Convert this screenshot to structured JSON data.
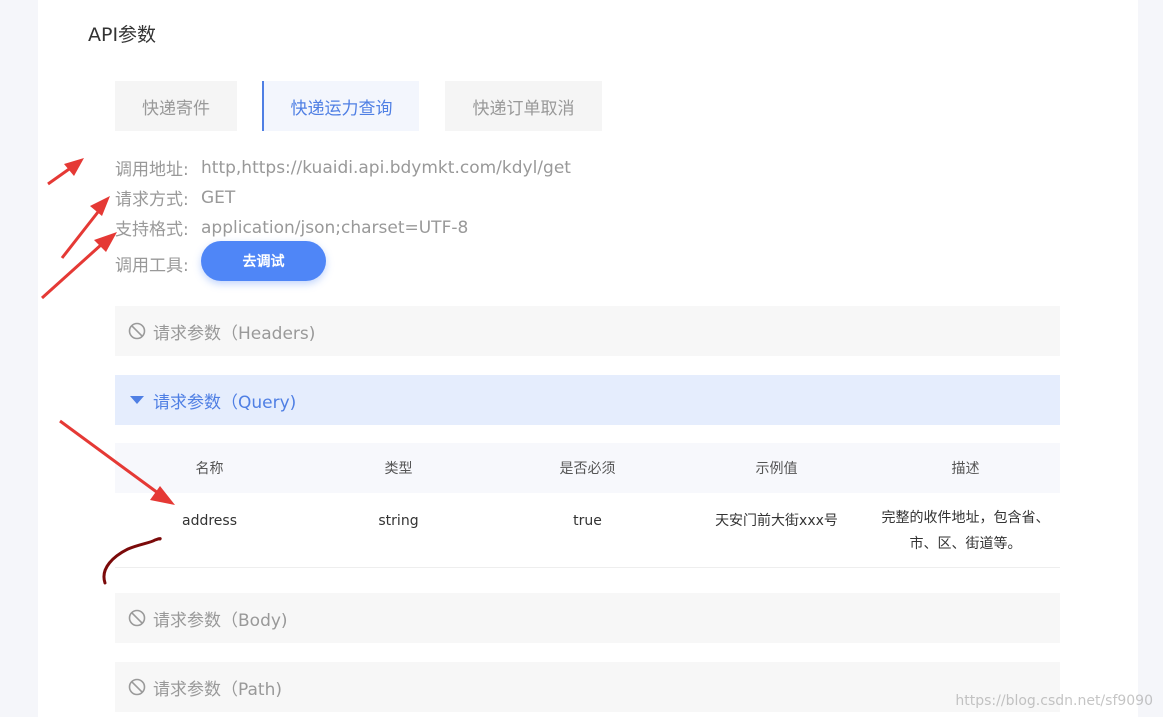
{
  "section_title": "API参数",
  "tabs": [
    {
      "label": "快递寄件",
      "active": false
    },
    {
      "label": "快递运力查询",
      "active": true
    },
    {
      "label": "快递订单取消",
      "active": false
    }
  ],
  "info": {
    "address_label": "调用地址:",
    "address_value": "http,https://kuaidi.api.bdymkt.com/kdyl/get",
    "method_label": "请求方式:",
    "method_value": "GET",
    "format_label": "支持格式:",
    "format_value": "application/json;charset=UTF-8",
    "tool_label": "调用工具:",
    "tool_button": "去调试"
  },
  "accordions": {
    "headers": "请求参数（Headers)",
    "query": "请求参数（Query)",
    "body": "请求参数（Body)",
    "path": "请求参数（Path)"
  },
  "table": {
    "headers": [
      "名称",
      "类型",
      "是否必须",
      "示例值",
      "描述"
    ],
    "rows": [
      {
        "name": "address",
        "type": "string",
        "required": "true",
        "example": "天安门前大街xxx号",
        "desc_line1": "完整的收件地址，包含省、",
        "desc_line2": "市、区、街道等。"
      }
    ]
  },
  "watermark": "https://blog.csdn.net/sf9090",
  "colors": {
    "accent": "#4f86f7",
    "annotation_arrow": "#e53935",
    "annotation_scribble": "#7b0a0a"
  },
  "icons": {
    "disabled": "ban-icon",
    "expanded": "caret-down-icon"
  }
}
